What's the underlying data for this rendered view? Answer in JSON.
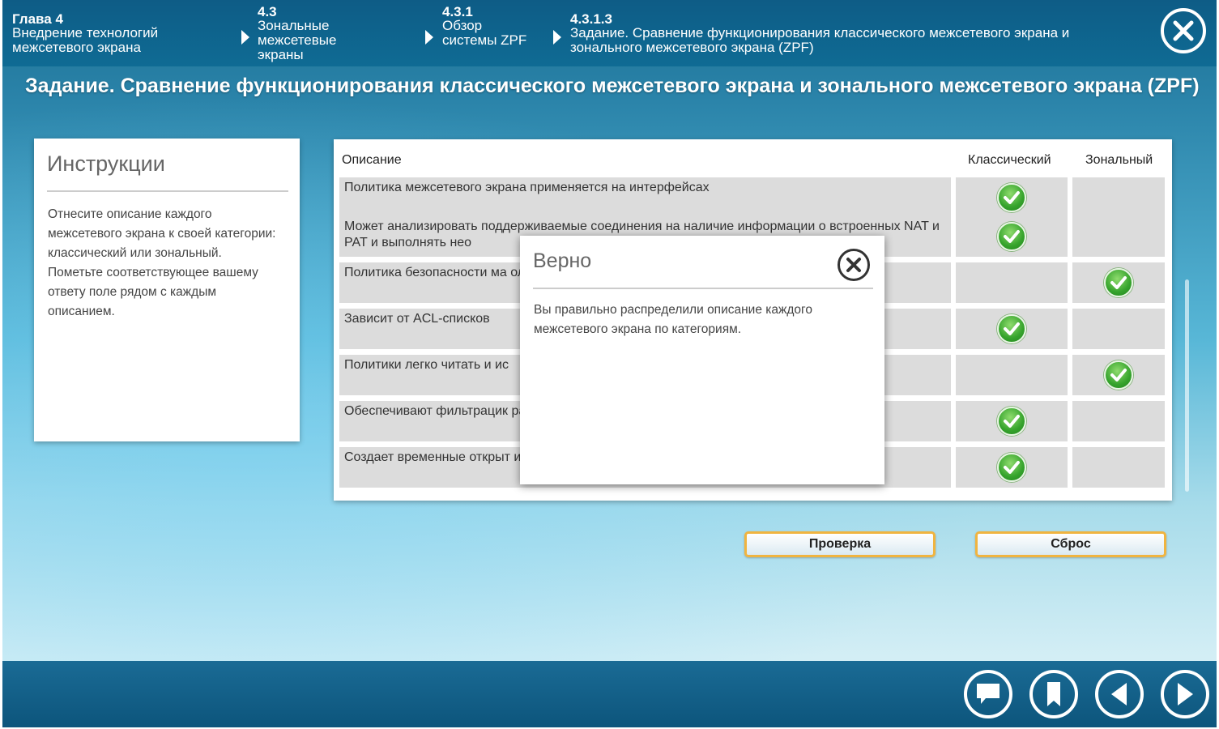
{
  "breadcrumbs": [
    {
      "num": "Глава 4",
      "text": "Внедрение технологий межсетевого экрана"
    },
    {
      "num": "4.3",
      "text": "Зональные межсетевые экраны"
    },
    {
      "num": "4.3.1",
      "text": "Обзор системы ZPF"
    },
    {
      "num": "4.3.1.3",
      "text": "Задание. Сравнение функционирования классического межсетевого экрана и зонального межсетевого экрана (ZPF)"
    }
  ],
  "page_title": "Задание. Сравнение функционирования классического межсетевого экрана и зонального межсетевого экрана (ZPF)",
  "instructions": {
    "title": "Инструкции",
    "body": "Отнесите описание каждого межсетевого экрана к своей категории: классический или зональный. Пометьте соответствующее вашему ответу поле рядом с каждым описанием."
  },
  "table": {
    "headers": {
      "description": "Описание",
      "classic": "Классический",
      "zonal": "Зональный"
    },
    "rows": [
      {
        "description": "Политика межсетевого экрана применяется на интерфейсах",
        "answer": "classic"
      },
      {
        "description": "Может анализировать поддерживаемые соединения на наличие информации о встроенных NAT и PAT и выполнять нео",
        "answer": "classic"
      },
      {
        "description": "Политика безопасности ма                                                                    олько не будет явного разрешения",
        "answer": "zonal"
      },
      {
        "description": "Зависит от ACL-списков",
        "answer": "classic"
      },
      {
        "description": "Политики легко читать и ис",
        "answer": "zonal"
      },
      {
        "description": "Обеспечивают фильтрацик                                                                   ратором",
        "answer": "classic"
      },
      {
        "description": "Создает временные открыт                                                                  ика",
        "answer": "classic"
      }
    ]
  },
  "buttons": {
    "check": "Проверка",
    "reset": "Сброс"
  },
  "modal": {
    "title": "Верно",
    "body": "Вы правильно распределили описание каждого межсетевого экрана по категориям."
  },
  "footer_icons": [
    "chat-icon",
    "bookmark-icon",
    "previous-icon",
    "next-icon"
  ],
  "colors": {
    "accent": "#f0b440",
    "header": "#0f6b94",
    "check": "#35a32c"
  }
}
